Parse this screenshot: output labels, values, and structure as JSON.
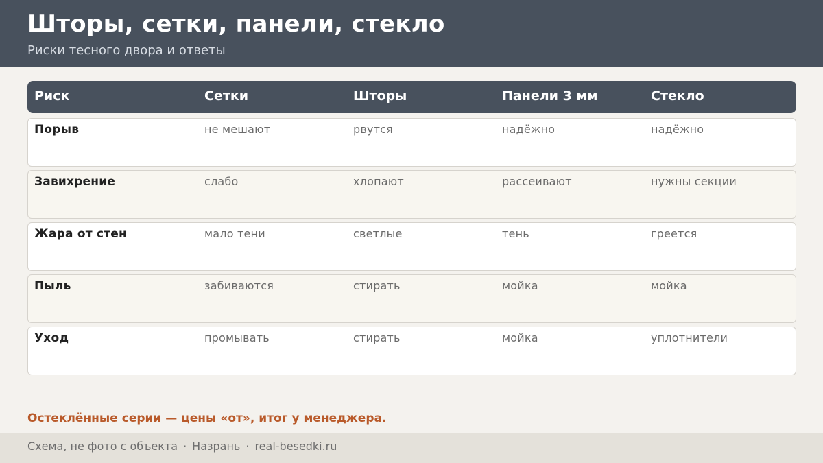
{
  "header": {
    "title": "Шторы, сетки, панели, стекло",
    "subtitle": "Риски тесного двора и ответы"
  },
  "table": {
    "columns": [
      "Риск",
      "Сетки",
      "Шторы",
      "Панели 3 мм",
      "Стекло"
    ],
    "rows": [
      [
        "Порыв",
        "не мешают",
        "рвутся",
        "надёжно",
        "надёжно"
      ],
      [
        "Завихрение",
        "слабо",
        "хлопают",
        "рассеивают",
        "нужны секции"
      ],
      [
        "Жара от стен",
        "мало тени",
        "светлые",
        "тень",
        "греется"
      ],
      [
        "Пыль",
        "забиваются",
        "стирать",
        "мойка",
        "мойка"
      ],
      [
        "Уход",
        "промывать",
        "стирать",
        "мойка",
        "уплотнители"
      ]
    ]
  },
  "note": "Остеклённые серии — цены «от», итог у менеджера.",
  "footer": {
    "items": [
      "Схема, не фото с объекта",
      "Назрань",
      "real-besedki.ru"
    ],
    "separator": "·"
  },
  "colors": {
    "header_bg": "#48515d",
    "accent": "#b95a2a",
    "page_bg": "#f4f2ee"
  }
}
